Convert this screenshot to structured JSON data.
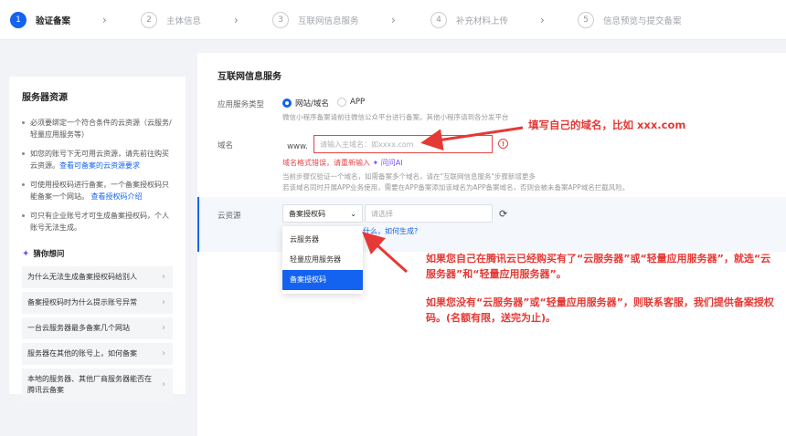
{
  "steps": [
    {
      "num": "1",
      "label": "验证备案"
    },
    {
      "num": "2",
      "label": "主体信息"
    },
    {
      "num": "3",
      "label": "互联网信息服务"
    },
    {
      "num": "4",
      "label": "补充材料上传"
    },
    {
      "num": "5",
      "label": "信息预览与提交备案"
    }
  ],
  "sidebar": {
    "title": "服务器资源",
    "notes": [
      {
        "text": "必须要绑定一个符合条件的云资源（云服务/轻量应用服务等）",
        "link": ""
      },
      {
        "text": "如您的账号下无可用云资源，请先前往购买云资源。",
        "link": "查看可备案的云资源要求"
      },
      {
        "text": "可使用授权码进行备案，一个备案授权码只能备案一个网站。",
        "link": "查看授权码介绍"
      },
      {
        "text": "可只有企业账号才可生成备案授权码，个人账号无法生成。",
        "link": ""
      }
    ],
    "guess_title": "猜你想问",
    "questions": [
      "为什么无法生成备案授权码给别人",
      "备案授权码时为什么提示账号异常",
      "一台云服务器最多备案几个网站",
      "服务器在其他的账号上，如何备案",
      "本地的服务器、其他厂商服务器能否在腾讯云备案"
    ]
  },
  "main": {
    "title": "互联网信息服务",
    "service_type_label": "应用服务类型",
    "service_options": [
      "网站/域名",
      "APP"
    ],
    "service_hint": "微信小程序备案请前往微信公众平台进行备案。其他小程序请到各分发平台",
    "domain_label": "域名",
    "domain_prefix": "www.",
    "domain_placeholder": "请输入主域名：如xxxx.com",
    "domain_error": "域名格式错误，请重新输入",
    "ask_ai": "问问AI",
    "domain_hint1": "当前步骤仅验证一个域名，如需备案多个域名，请在\"互联网信息服务\"步骤新增更多",
    "domain_hint2": "若该域名同时开展APP业务使用，需要在APP备案添加该域名为APP备案域名，否则会被未备案APP域名拦截风险。",
    "cloud_label": "云资源",
    "cloud_type_selected": "备案授权码",
    "cloud_resource_placeholder": "请选择",
    "how_generate": "什么，如何生成?",
    "dropdown_options": [
      "云服务器",
      "轻量应用服务器",
      "备案授权码"
    ]
  },
  "annotations": {
    "domain_tip": "填写自己的域名，比如 xxx.com",
    "server_tip": "如果您自己在腾讯云已经购买有了“云服务器”或“轻量应用服务器”，就选“云服务器”和“轻量应用服务器”。",
    "code_tip": "如果您没有“云服务器”或“轻量应用服务器”，则联系客服，我们提供备案授权码。(名额有限，送完为止)。",
    "color": "#e53935"
  },
  "colors": {
    "accent": "#1463f0",
    "error": "#e54545"
  }
}
